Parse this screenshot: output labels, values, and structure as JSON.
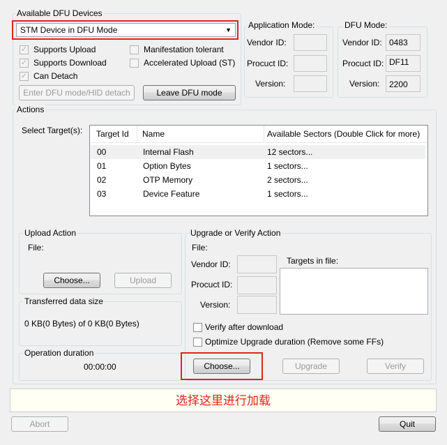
{
  "dfu_devices": {
    "group_title": "Available DFU Devices",
    "selected_device": "STM Device in DFU Mode",
    "supports_upload": "Supports Upload",
    "supports_download": "Supports Download",
    "can_detach": "Can Detach",
    "manifestation_tolerant": "Manifestation tolerant",
    "accelerated_upload": "Accelerated Upload (ST)",
    "enter_dfu_button": "Enter DFU mode/HID detach",
    "leave_dfu_button": "Leave DFU mode"
  },
  "app_mode": {
    "title": "Application Mode:",
    "vendor_label": "Vendor ID:",
    "product_label": "Procuct ID:",
    "version_label": "Version:",
    "vendor_value": "",
    "product_value": "",
    "version_value": ""
  },
  "dfu_mode": {
    "title": "DFU Mode:",
    "vendor_label": "Vendor ID:",
    "product_label": "Procuct ID:",
    "version_label": "Version:",
    "vendor_value": "0483",
    "product_value": "DF11",
    "version_value": "2200"
  },
  "actions": {
    "group_title": "Actions",
    "select_target_label": "Select Target(s):",
    "columns": [
      "Target Id",
      "Name",
      "Available Sectors (Double Click for more)"
    ],
    "targets": [
      {
        "id": "00",
        "name": "Internal Flash",
        "sectors": "12 sectors..."
      },
      {
        "id": "01",
        "name": "Option Bytes",
        "sectors": "1 sectors..."
      },
      {
        "id": "02",
        "name": "OTP Memory",
        "sectors": "2 sectors..."
      },
      {
        "id": "03",
        "name": "Device Feature",
        "sectors": "1 sectors..."
      }
    ]
  },
  "upload": {
    "group_title": "Upload Action",
    "file_label": "File:",
    "choose_button": "Choose...",
    "upload_button": "Upload"
  },
  "transferred": {
    "group_title": "Transferred data size",
    "value": "0 KB(0 Bytes) of 0 KB(0 Bytes)"
  },
  "duration": {
    "group_title": "Operation duration",
    "value": "00:00:00"
  },
  "upgrade": {
    "group_title": "Upgrade or Verify Action",
    "file_label": "File:",
    "vendor_label": "Vendor ID:",
    "product_label": "Procuct ID:",
    "version_label": "Version:",
    "targets_in_file_label": "Targets in file:",
    "verify_after_download": "Verify after download",
    "optimize_upgrade": "Optimize Upgrade duration (Remove some FFs)",
    "choose_button": "Choose...",
    "upgrade_button": "Upgrade",
    "verify_button": "Verify"
  },
  "status_bar": {
    "annotation": "选择这里进行加载",
    "annotation_color": "#e0241d"
  },
  "footer": {
    "abort_button": "Abort",
    "quit_button": "Quit"
  }
}
